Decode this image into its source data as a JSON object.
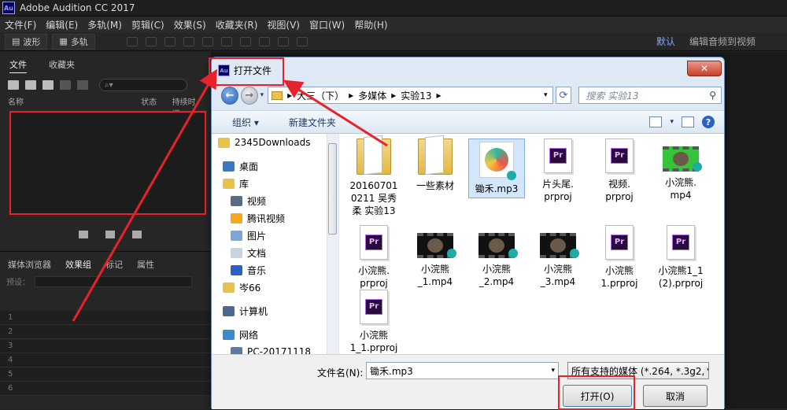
{
  "app": {
    "title": "Adobe Audition CC 2017",
    "icon_text": "Au"
  },
  "menubar": [
    "文件(F)",
    "编辑(E)",
    "多轨(M)",
    "剪辑(C)",
    "效果(S)",
    "收藏夹(R)",
    "视图(V)",
    "窗口(W)",
    "帮助(H)"
  ],
  "toolbar": {
    "waveform_label": "波形",
    "multitrack_label": "多轨",
    "workspace_default": "默认",
    "workspace_edit": "编辑音频到视频"
  },
  "files_panel": {
    "tabs": [
      "文件",
      "收藏夹"
    ],
    "col_name": "名称",
    "col_status": "状态",
    "col_duration": "持续时间"
  },
  "media_panel": {
    "tabs": [
      "媒体浏览器",
      "效果组",
      "标记",
      "属性"
    ],
    "preset_label": "预设：",
    "rows": [
      "1",
      "2",
      "3",
      "4",
      "5",
      "6"
    ]
  },
  "dialog": {
    "title": "打开文件",
    "close_label": "✕",
    "address": [
      "大三（下）",
      "多媒体",
      "实验13"
    ],
    "search_placeholder": "搜索 实验13",
    "organize_label": "组织 ▾",
    "new_folder_label": "新建文件夹",
    "nav_items": [
      {
        "label": "2345Downloads",
        "icon": "folder-icon"
      },
      {
        "label": "桌面",
        "icon": "desktop-icon"
      },
      {
        "label": "库",
        "icon": "library-icon"
      },
      {
        "label": "视频",
        "icon": "video-icon"
      },
      {
        "label": "腾讯视频",
        "icon": "tencent-video-icon"
      },
      {
        "label": "图片",
        "icon": "pictures-icon"
      },
      {
        "label": "文档",
        "icon": "documents-icon"
      },
      {
        "label": "音乐",
        "icon": "music-icon"
      },
      {
        "label": "岑66",
        "icon": "user-folder-icon"
      },
      {
        "label": "计算机",
        "icon": "computer-icon"
      },
      {
        "label": "网络",
        "icon": "network-icon"
      },
      {
        "label": "PC-20171118",
        "icon": "pc-icon"
      }
    ],
    "files": [
      {
        "label": "20160701\n0211 吴秀\n柔 实验13",
        "type": "folder"
      },
      {
        "label": "一些素材",
        "type": "folder"
      },
      {
        "label": "锄禾.mp3",
        "type": "mp3",
        "selected": true
      },
      {
        "label": "片头尾.\nprproj",
        "type": "prproj"
      },
      {
        "label": "视频.\nprproj",
        "type": "prproj"
      },
      {
        "label": "小浣熊.\nmp4",
        "type": "mp4-green"
      },
      {
        "label": "小浣熊.\nprproj",
        "type": "prproj"
      },
      {
        "label": "小浣熊\n_1.mp4",
        "type": "mp4"
      },
      {
        "label": "小浣熊\n_2.mp4",
        "type": "mp4"
      },
      {
        "label": "小浣熊\n_3.mp4",
        "type": "mp4"
      },
      {
        "label": "小浣熊\n1.prproj",
        "type": "prproj"
      },
      {
        "label": "小浣熊1_1\n(2).prproj",
        "type": "prproj"
      },
      {
        "label": "小浣熊\n1_1.prproj",
        "type": "prproj"
      }
    ],
    "filename_label": "文件名(N):",
    "filename_value": "锄禾.mp3",
    "filetype_value": "所有支持的媒体 (*.264, *.3g2,",
    "open_label": "打开(O)",
    "cancel_label": "取消",
    "pr_icon_text": "Pr"
  },
  "colors": {
    "highlight": "#e8222b",
    "accent": "#2a62c4"
  }
}
